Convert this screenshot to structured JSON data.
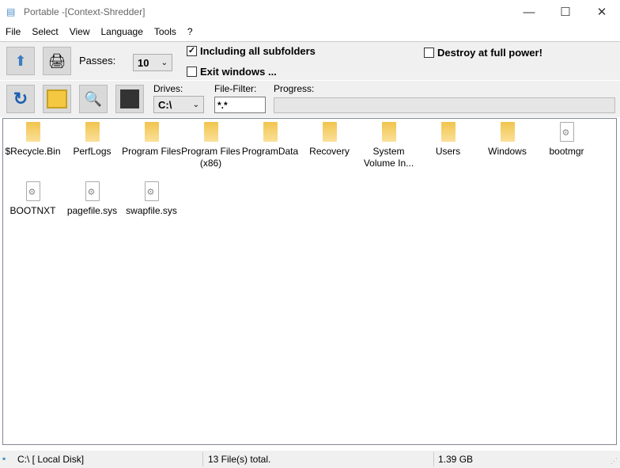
{
  "window": {
    "title": "Portable  -[Context-Shredder]",
    "minimize": "—",
    "maximize": "☐",
    "close": "✕"
  },
  "menu": [
    "File",
    "Select",
    "View",
    "Language",
    "Tools",
    "?"
  ],
  "toolbar": {
    "passes_label": "Passes:",
    "passes_value": "10",
    "include_subfolders": "Including all subfolders",
    "include_checked": true,
    "exit_windows": "Exit windows ...",
    "exit_checked": false,
    "destroy_full": "Destroy at full power!",
    "destroy_checked": false,
    "drives_label": "Drives:",
    "drive_value": "C:\\",
    "filter_label": "File-Filter:",
    "filter_value": "*.*",
    "progress_label": "Progress:",
    "progress": 0
  },
  "files": [
    {
      "name": "$Recycle.Bin",
      "type": "folder"
    },
    {
      "name": "PerfLogs",
      "type": "folder"
    },
    {
      "name": "Program Files",
      "type": "folder"
    },
    {
      "name": "Program Files (x86)",
      "type": "folder"
    },
    {
      "name": "ProgramData",
      "type": "folder"
    },
    {
      "name": "Recovery",
      "type": "folder"
    },
    {
      "name": "System Volume In...",
      "type": "folder"
    },
    {
      "name": "Users",
      "type": "folder"
    },
    {
      "name": "Windows",
      "type": "folder"
    },
    {
      "name": "bootmgr",
      "type": "file"
    },
    {
      "name": "BOOTNXT",
      "type": "file"
    },
    {
      "name": "pagefile.sys",
      "type": "file"
    },
    {
      "name": "swapfile.sys",
      "type": "file"
    }
  ],
  "status": {
    "drive": "C:\\ [ Local Disk]",
    "count": "13  File(s) total.",
    "size": "1.39 GB"
  }
}
